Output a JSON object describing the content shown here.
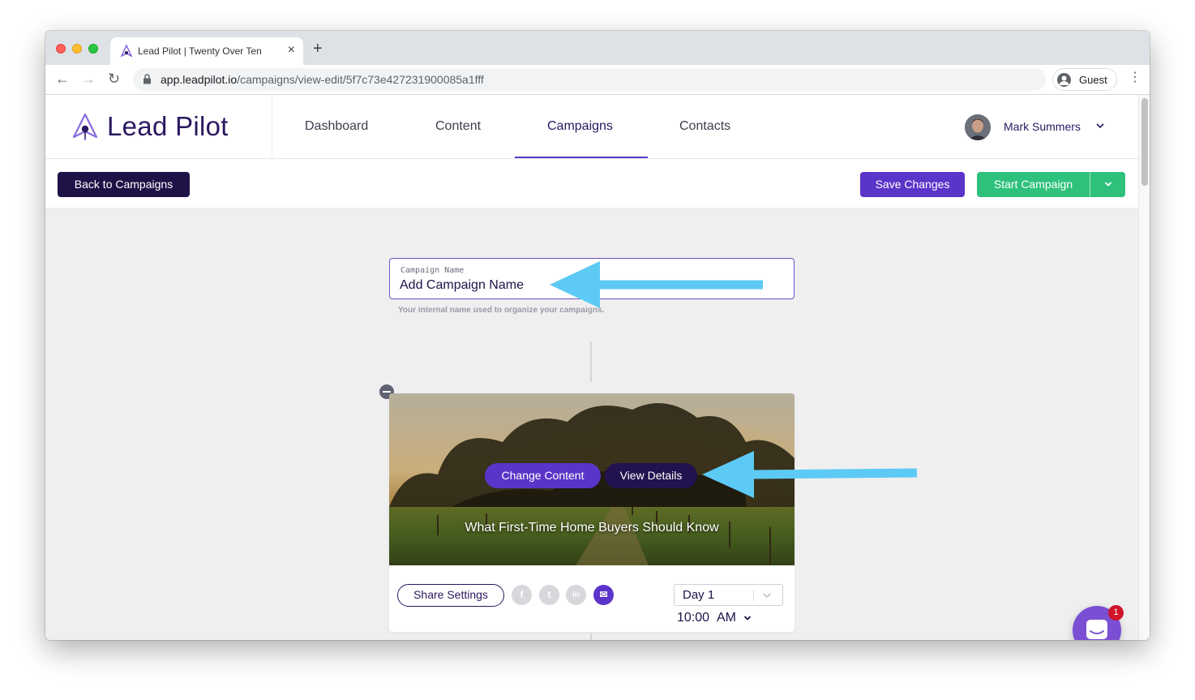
{
  "browser": {
    "tab_title": "Lead Pilot | Twenty Over Ten",
    "url_host": "app.leadpilot.io",
    "url_path": "/campaigns/view-edit/5f7c73e427231900085a1fff",
    "profile_label": "Guest"
  },
  "app": {
    "logo": "Lead Pilot",
    "nav": [
      "Dashboard",
      "Content",
      "Campaigns",
      "Contacts"
    ],
    "active_nav": "Campaigns",
    "user_name": "Mark Summers"
  },
  "toolbar": {
    "back_label": "Back to Campaigns",
    "save_label": "Save Changes",
    "start_label": "Start Campaign"
  },
  "campaign_name": {
    "label": "Campaign Name",
    "value": "Add Campaign Name",
    "help": "Your internal name used to organize your campaigns."
  },
  "content_card": {
    "change_label": "Change Content",
    "view_label": "View Details",
    "title": "What First-Time Home Buyers Should Know",
    "share_label": "Share Settings",
    "social": {
      "facebook": "f",
      "twitter": "t",
      "linkedin": "in",
      "email": "✉"
    },
    "day": "Day 1",
    "time": "10:00",
    "ampm": "AM"
  },
  "chat": {
    "badge": "1"
  },
  "colors": {
    "brand_dark": "#1f1247",
    "brand_purple": "#5b34c9",
    "success_green": "#2ec17b",
    "arrow_blue": "#5ccaf5"
  }
}
